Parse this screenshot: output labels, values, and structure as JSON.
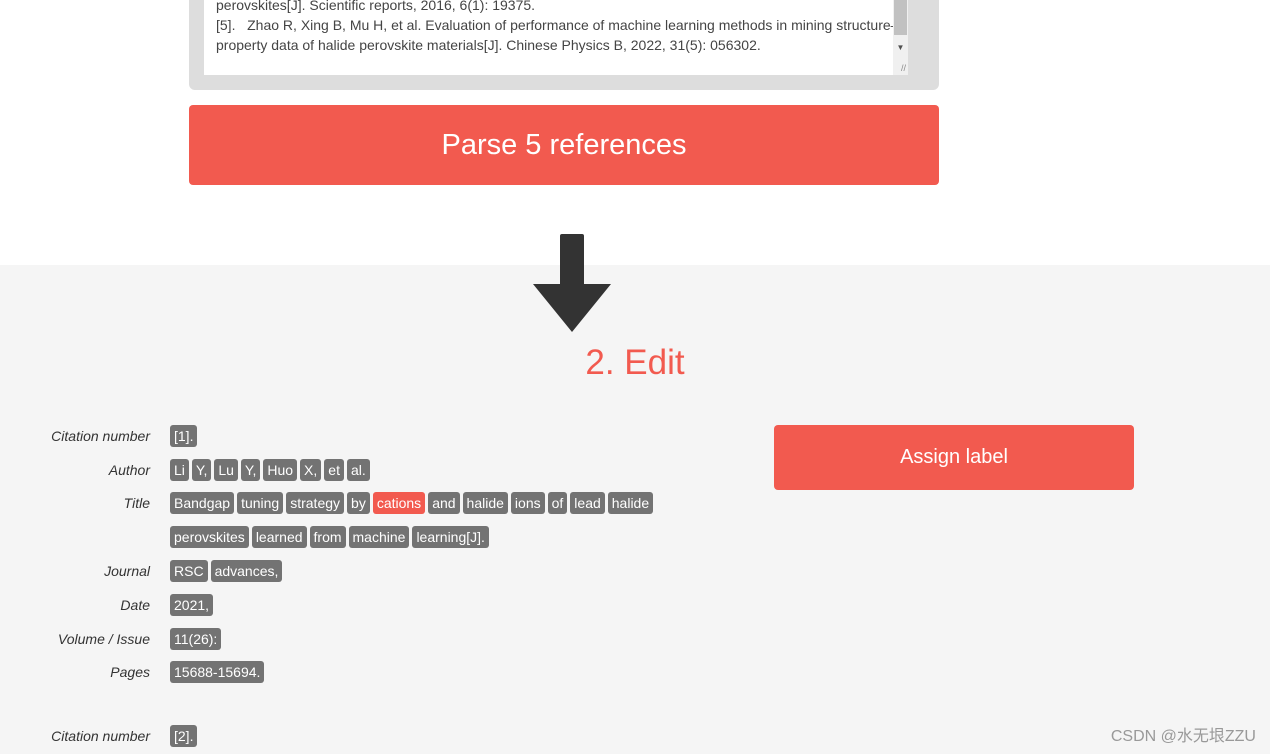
{
  "input": {
    "text": "perovskites[J]. Scientific reports, 2016, 6(1): 19375.\n[5].   Zhao R, Xing B, Mu H, et al. Evaluation of performance of machine learning methods in mining structure–property data of halide perovskite materials[J]. Chinese Physics B, 2022, 31(5): 056302."
  },
  "parse_button": "Parse 5 references",
  "edit_title": "2. Edit",
  "assign_button": "Assign label",
  "colors": {
    "accent": "#f25a4f",
    "token": "#737373",
    "section_bg": "#f5f5f5"
  },
  "references": [
    {
      "fields": [
        {
          "label": "Citation number",
          "tokens": [
            "[1]."
          ]
        },
        {
          "label": "Author",
          "tokens": [
            "Li",
            "Y,",
            "Lu",
            "Y,",
            "Huo",
            "X,",
            "et",
            "al."
          ]
        },
        {
          "label": "Title",
          "tokens": [
            "Bandgap",
            "tuning",
            "strategy",
            "by",
            "cations",
            "and",
            "halide",
            "ions",
            "of",
            "lead",
            "halide",
            "perovskites",
            "learned",
            "from",
            "machine",
            "learning[J]."
          ],
          "selected": [
            4
          ]
        },
        {
          "label": "Journal",
          "tokens": [
            "RSC",
            "advances,"
          ]
        },
        {
          "label": "Date",
          "tokens": [
            "2021,"
          ]
        },
        {
          "label": "Volume / Issue",
          "tokens": [
            "11(26):"
          ]
        },
        {
          "label": "Pages",
          "tokens": [
            "15688-15694."
          ]
        }
      ]
    },
    {
      "fields": [
        {
          "label": "Citation number",
          "tokens": [
            "[2]."
          ]
        }
      ]
    }
  ],
  "watermark": "CSDN @水无垠ZZU"
}
